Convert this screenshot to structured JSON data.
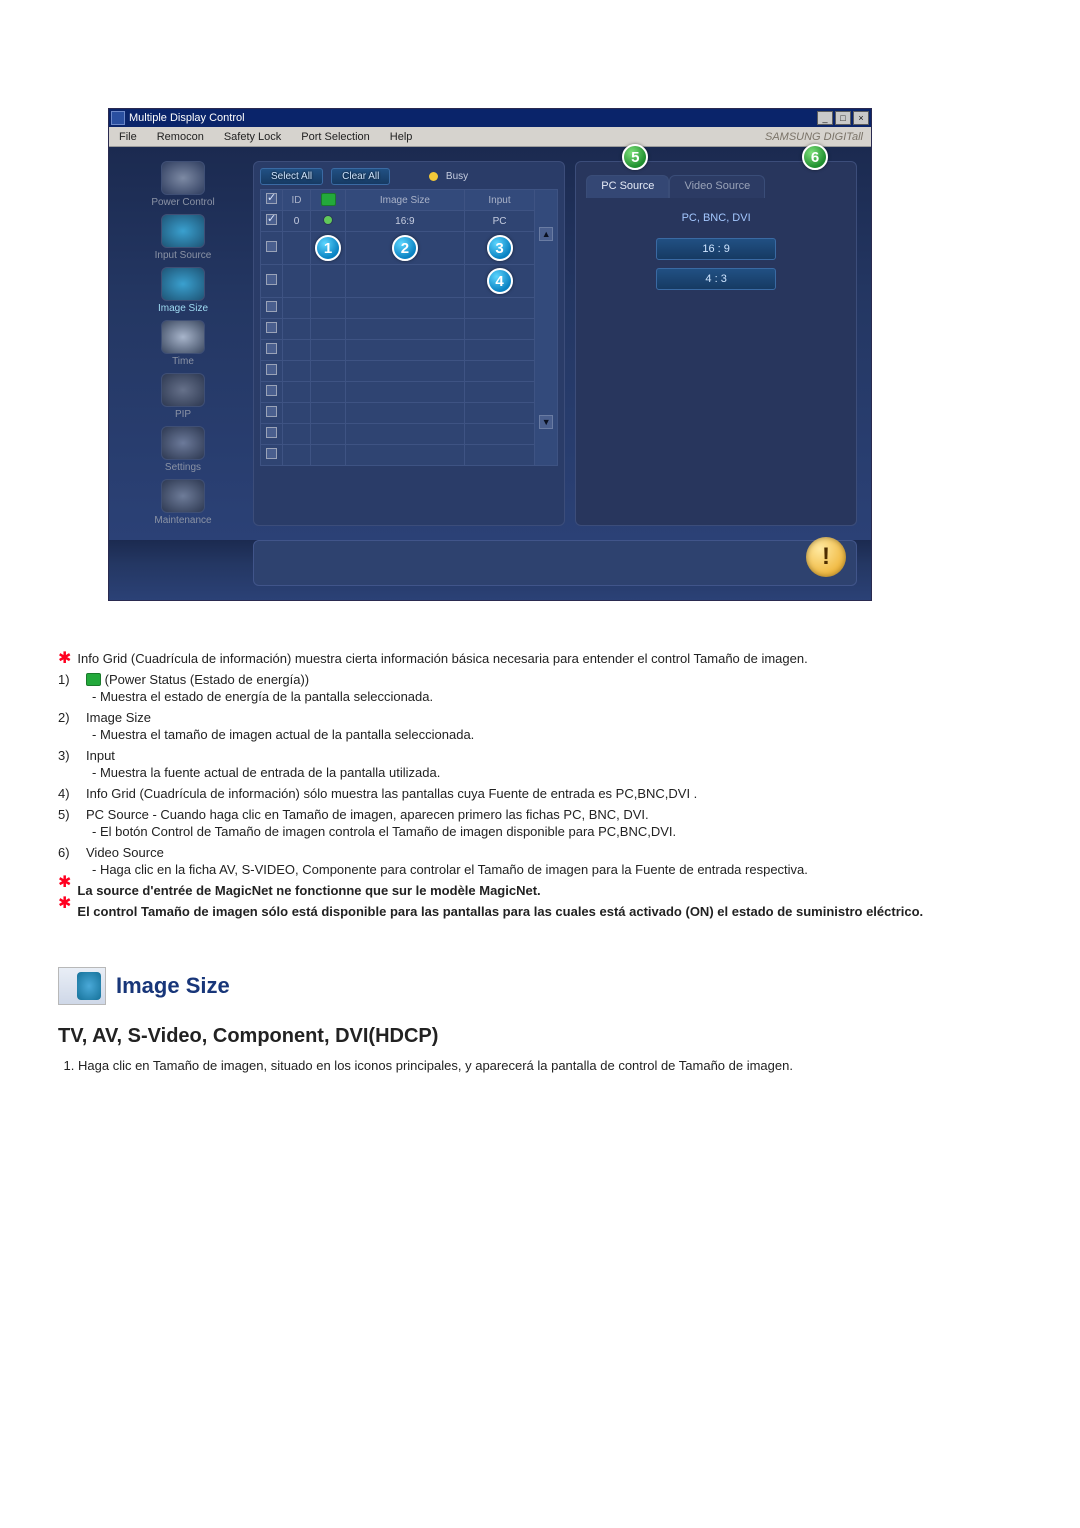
{
  "app": {
    "window_title": "Multiple Display Control",
    "minimize_label": "_",
    "maximize_label": "□",
    "close_label": "×",
    "menubar": {
      "file": "File",
      "remocon": "Remocon",
      "safety_lock": "Safety Lock",
      "port_selection": "Port Selection",
      "help": "Help",
      "brand": "SAMSUNG DIGITall"
    },
    "sidebar": {
      "power": "Power Control",
      "input": "Input Source",
      "image": "Image Size",
      "time": "Time",
      "pip": "PIP",
      "settings": "Settings",
      "maintenance": "Maintenance"
    },
    "toolbar": {
      "select_all": "Select All",
      "clear_all": "Clear All",
      "busy": "Busy"
    },
    "grid": {
      "headers": {
        "check": "✓",
        "id": "ID",
        "power": "⏻",
        "image_size": "Image Size",
        "input": "Input"
      },
      "rows": [
        {
          "checked": true,
          "id": "0",
          "power": "on",
          "image_size": "16:9",
          "input": "PC"
        },
        {
          "checked": false,
          "id": "",
          "power": "",
          "image_size": "",
          "input": ""
        },
        {
          "checked": false,
          "id": "",
          "power": "",
          "image_size": "",
          "input": ""
        },
        {
          "checked": false,
          "id": "",
          "power": "",
          "image_size": "",
          "input": ""
        },
        {
          "checked": false,
          "id": "",
          "power": "",
          "image_size": "",
          "input": ""
        },
        {
          "checked": false,
          "id": "",
          "power": "",
          "image_size": "",
          "input": ""
        },
        {
          "checked": false,
          "id": "",
          "power": "",
          "image_size": "",
          "input": ""
        },
        {
          "checked": false,
          "id": "",
          "power": "",
          "image_size": "",
          "input": ""
        },
        {
          "checked": false,
          "id": "",
          "power": "",
          "image_size": "",
          "input": ""
        },
        {
          "checked": false,
          "id": "",
          "power": "",
          "image_size": "",
          "input": ""
        },
        {
          "checked": false,
          "id": "",
          "power": "",
          "image_size": "",
          "input": ""
        }
      ]
    },
    "markers": {
      "m1": "1",
      "m2": "2",
      "m3": "3",
      "m4": "4",
      "m5": "5",
      "m6": "6"
    },
    "right_panel": {
      "tab_pc": "PC Source",
      "tab_video": "Video Source",
      "section_label": "PC, BNC, DVI",
      "ratio_169": "16 : 9",
      "ratio_43": "4 : 3"
    },
    "alert_glyph": "!"
  },
  "doc": {
    "intro_star": "Info Grid (Cuadrícula de información) muestra cierta información básica necesaria para entender el control Tamaño de imagen.",
    "items": {
      "n1_label": "1)",
      "n1_text": "(Power Status (Estado de energía))",
      "n1_sub": "- Muestra el estado de energía de la pantalla seleccionada.",
      "n2_label": "2)",
      "n2_text": "Image Size",
      "n2_sub": "- Muestra el tamaño de imagen actual de la pantalla seleccionada.",
      "n3_label": "3)",
      "n3_text": "Input",
      "n3_sub": "- Muestra la fuente actual de entrada de la pantalla utilizada.",
      "n4_label": "4)",
      "n4_text": "Info Grid (Cuadrícula de información) sólo muestra las pantallas cuya Fuente de entrada es PC,BNC,DVI .",
      "n5_label": "5)",
      "n5_text": "PC Source - Cuando haga clic en Tamaño de imagen, aparecen primero las fichas PC, BNC, DVI.",
      "n5_sub": "- El botón Control de Tamaño de imagen controla el Tamaño de imagen disponible para PC,BNC,DVI.",
      "n6_label": "6)",
      "n6_text": "Video Source",
      "n6_sub": "- Haga clic en la ficha AV, S-VIDEO, Componente para controlar el Tamaño de imagen para la Fuente de entrada respectiva."
    },
    "warn1": "La source d'entrée de MagicNet ne fonctionne que sur le modèle MagicNet.",
    "warn2": "El control Tamaño de imagen sólo está disponible para las pantallas para las cuales está activado (ON) el estado de suministro eléctrico.",
    "section_title": "Image Size",
    "subheading": "TV, AV, S-Video, Component, DVI(HDCP)",
    "ordered_1": "Haga clic en Tamaño de imagen, situado en los iconos principales, y aparecerá la pantalla de control de Tamaño de imagen."
  }
}
